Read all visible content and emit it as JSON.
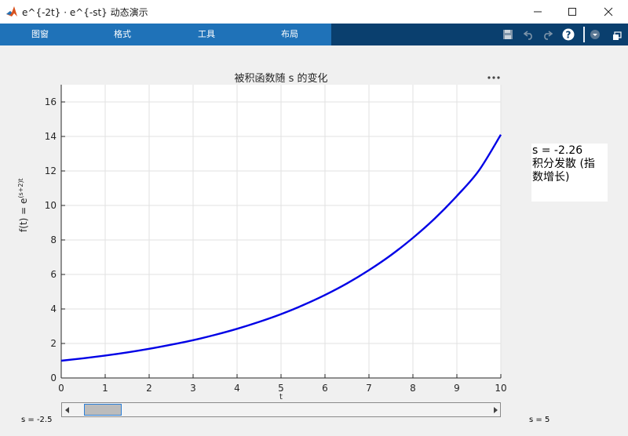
{
  "window": {
    "title": "e^{-2t} · e^{-st} 动态演示"
  },
  "toolstrip": {
    "tabs": [
      "图窗",
      "格式",
      "工具",
      "布局"
    ]
  },
  "plot": {
    "title": "被积函数随 s 的变化",
    "ylabel_base": "f(t) = e",
    "ylabel_exp": "(s+2)t",
    "xlabel": "t"
  },
  "chart_data": {
    "type": "line",
    "x": [
      0,
      0.5,
      1,
      1.5,
      2,
      2.5,
      3,
      3.5,
      4,
      4.5,
      5,
      5.5,
      6,
      6.5,
      7,
      7.5,
      8,
      8.5,
      9,
      9.5,
      10
    ],
    "series": [
      {
        "color": "#0000e6",
        "values": [
          1.0,
          1.14,
          1.3,
          1.48,
          1.69,
          1.93,
          2.19,
          2.5,
          2.85,
          3.25,
          3.7,
          4.22,
          4.81,
          5.48,
          6.25,
          7.12,
          8.12,
          9.25,
          10.55,
          12.02,
          14.1
        ]
      }
    ],
    "xlim": [
      0,
      10
    ],
    "ylim": [
      0,
      17
    ],
    "xticks": [
      "0",
      "1",
      "2",
      "3",
      "4",
      "5",
      "6",
      "7",
      "8",
      "9",
      "10"
    ],
    "yticks": [
      "0",
      "2",
      "4",
      "6",
      "8",
      "10",
      "12",
      "14",
      "16"
    ],
    "grid": true
  },
  "annotation": {
    "line1": "s = -2.26",
    "line2": "积分发散 (指",
    "line3": "数增长)"
  },
  "slider": {
    "min_label": "s = -2.5",
    "max_label": "s = 5",
    "value": -2.26,
    "min": -2.5,
    "max": 5
  }
}
